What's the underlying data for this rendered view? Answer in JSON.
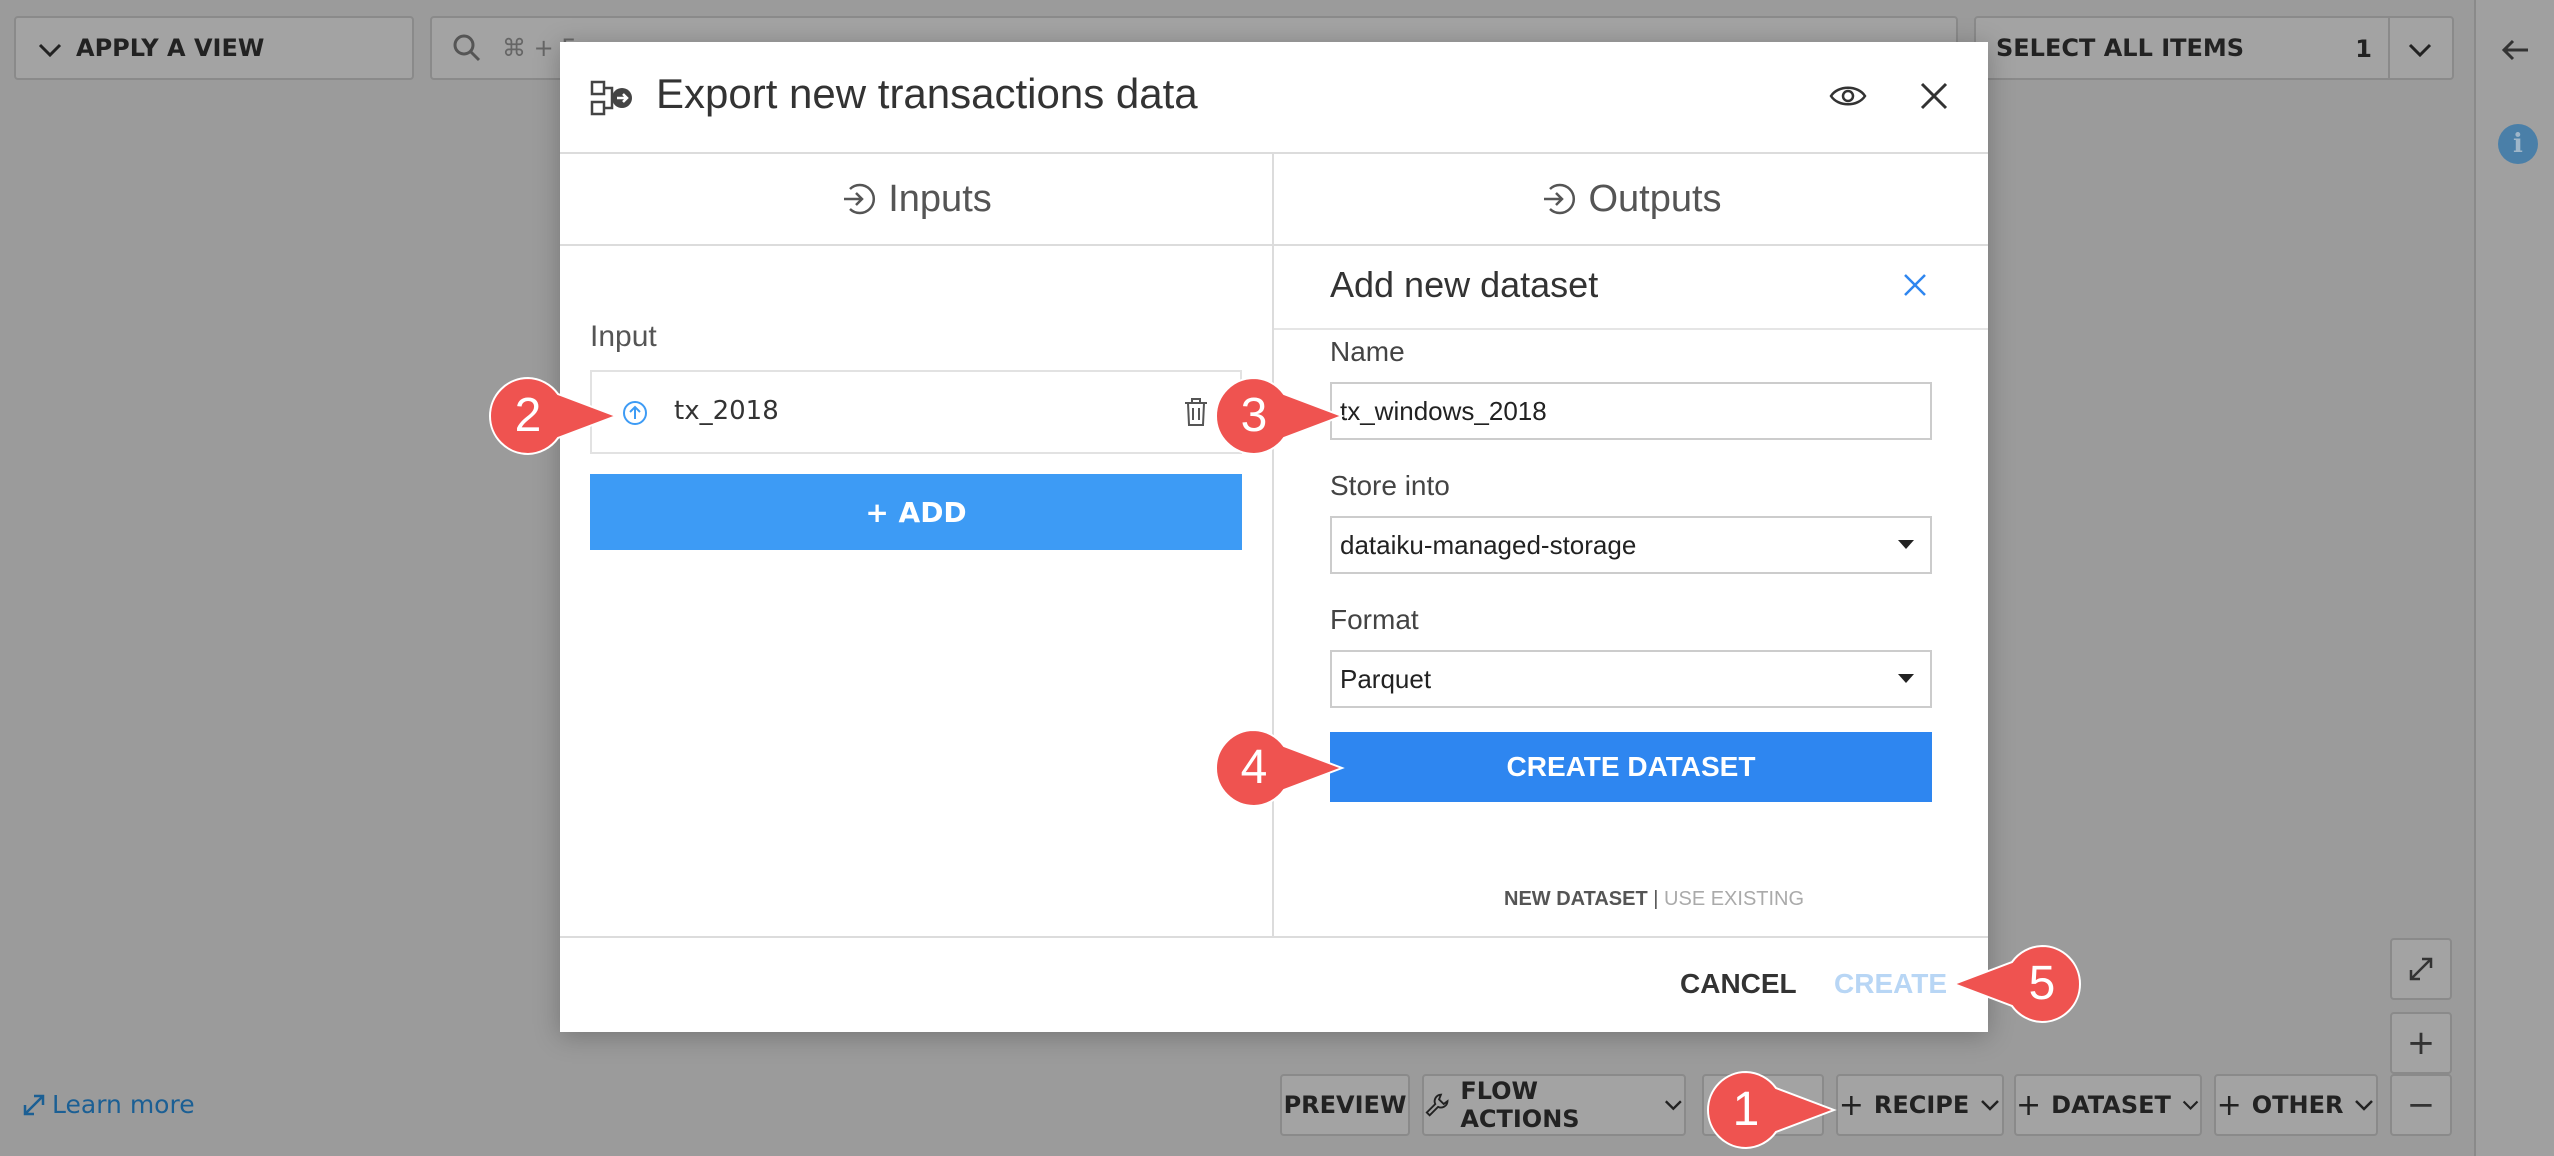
{
  "toolbar": {
    "apply_view": "APPLY A VIEW",
    "search_placeholder": "⌘ + F",
    "select_all": "SELECT ALL ITEMS",
    "selected_count": "1"
  },
  "learn_more": "Learn more",
  "bottom_actions": {
    "preview": "PREVIEW",
    "flow_actions": "FLOW ACTIONS",
    "recipe": "RECIPE",
    "dataset": "DATASET",
    "other": "OTHER"
  },
  "modal": {
    "title": "Export new transactions data",
    "inputs_tab": "Inputs",
    "outputs_tab": "Outputs",
    "input_section_label": "Input",
    "input_dataset": "tx_2018",
    "add_button": "+ ADD",
    "add_dataset_title": "Add new dataset",
    "name_label": "Name",
    "name_value": "tx_windows_2018",
    "store_label": "Store into",
    "store_value": "dataiku-managed-storage",
    "format_label": "Format",
    "format_value": "Parquet",
    "create_dataset_button": "CREATE DATASET",
    "new_dataset_link": "NEW DATASET",
    "separator": "|",
    "use_existing_link": "USE EXISTING",
    "cancel": "CANCEL",
    "create": "CREATE"
  },
  "callouts": {
    "one": "1",
    "two": "2",
    "three": "3",
    "four": "4",
    "five": "5"
  },
  "colors": {
    "primary_blue": "#3d9bf5",
    "callout_red": "#ef5350",
    "disabled_blue": "#b8d6f5"
  }
}
